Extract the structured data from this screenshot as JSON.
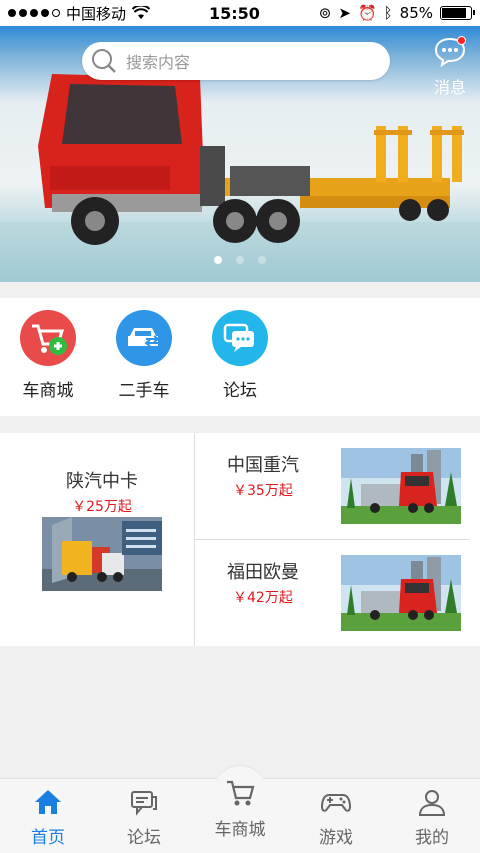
{
  "status_bar": {
    "carrier": "中国移动",
    "time": "15:50",
    "battery": "85%",
    "battery_level": 0.85
  },
  "header": {
    "search_placeholder": "搜索内容",
    "message_label": "消息"
  },
  "banner": {
    "page_count": 3,
    "active_page": 1
  },
  "menu": {
    "items": [
      {
        "label": "车商城",
        "icon": "cart-plus-icon",
        "color": "#e94b4b"
      },
      {
        "label": "二手车",
        "icon": "car-exchange-icon",
        "color": "#2f95e6"
      },
      {
        "label": "论坛",
        "icon": "chat-bubbles-icon",
        "color": "#23b6ea"
      }
    ]
  },
  "products": [
    {
      "name": "陕汽中卡",
      "price": "￥25万起"
    },
    {
      "name": "中国重汽",
      "price": "￥35万起"
    },
    {
      "name": "福田欧曼",
      "price": "￥42万起"
    }
  ],
  "tabs": [
    {
      "label": "首页",
      "icon": "home-icon",
      "active": true
    },
    {
      "label": "论坛",
      "icon": "forum-icon",
      "active": false
    },
    {
      "label": "车商城",
      "icon": "cart-icon",
      "active": false
    },
    {
      "label": "游戏",
      "icon": "gamepad-icon",
      "active": false
    },
    {
      "label": "我的",
      "icon": "user-icon",
      "active": false
    }
  ],
  "colors": {
    "accent": "#1a7fe0",
    "price": "#e0191e"
  }
}
